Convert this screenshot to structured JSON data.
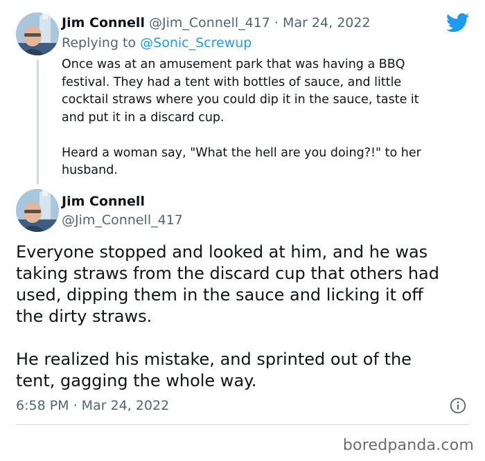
{
  "reply_tweet": {
    "author_name": "Jim Connell",
    "author_handle": "@Jim_Connell_417",
    "separator": "·",
    "date": "Mar 24, 2022",
    "replying_prefix": "Replying to",
    "replying_handle": "@Sonic_Screwup",
    "body": "Once was at an amusement park that was having a BBQ\nfestival. They had a tent with bottles of sauce, and little\ncocktail straws where you could dip it in the sauce, taste it\nand put it in a discard cup.\n\nHeard a woman say, \"What the hell are you doing?!\" to her\nhusband."
  },
  "main_tweet": {
    "author_name": "Jim Connell",
    "author_handle": "@Jim_Connell_417",
    "body": "Everyone stopped and looked at him, and he was\ntaking straws from the discard cup that others had\nused, dipping them in the sauce and licking it off\nthe dirty straws.\n\nHe realized his mistake, and sprinted out of the\ntent, gagging the whole way.",
    "timestamp": "6:58 PM · Mar 24, 2022"
  },
  "icons": {
    "brand": "twitter-bird-icon",
    "info": "info-icon"
  },
  "colors": {
    "twitter_blue": "#1d9bf0",
    "muted_text": "#536471",
    "primary_text": "#0f1419",
    "divider": "#cfd9de"
  },
  "watermark": "boredpanda.com"
}
